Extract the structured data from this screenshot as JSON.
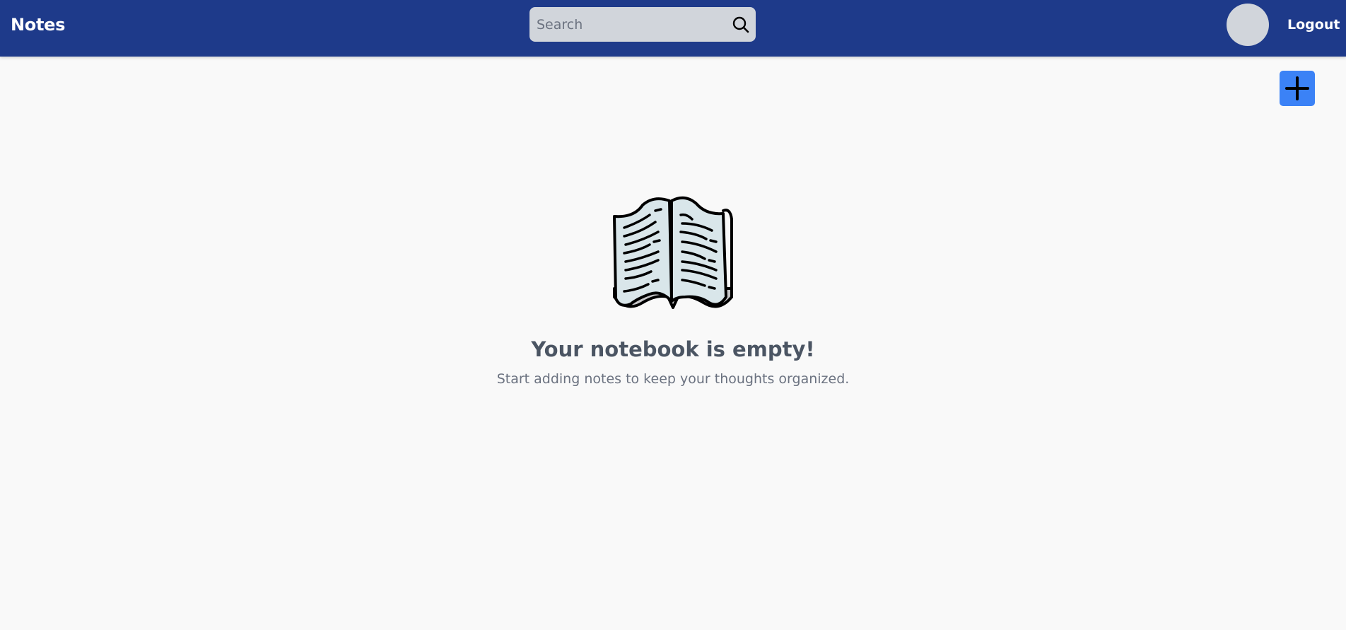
{
  "navbar": {
    "brand": "Notes",
    "search": {
      "placeholder": "Search",
      "value": "",
      "icon": "search-icon"
    },
    "logout_label": "Logout"
  },
  "actions": {
    "add_note_icon": "plus-icon"
  },
  "empty_state": {
    "illustration_icon": "open-book-icon",
    "title": "Your notebook is empty!",
    "subtitle": "Start adding notes to keep your thoughts organized."
  },
  "colors": {
    "navbar_bg": "#1e3a8a",
    "search_bg": "#d1d5db",
    "avatar_bg": "#d1d5db",
    "add_button_bg": "#3b82f6",
    "page_bg": "#f9f9f9",
    "title_text": "#4b5563",
    "subtitle_text": "#6b7280"
  }
}
